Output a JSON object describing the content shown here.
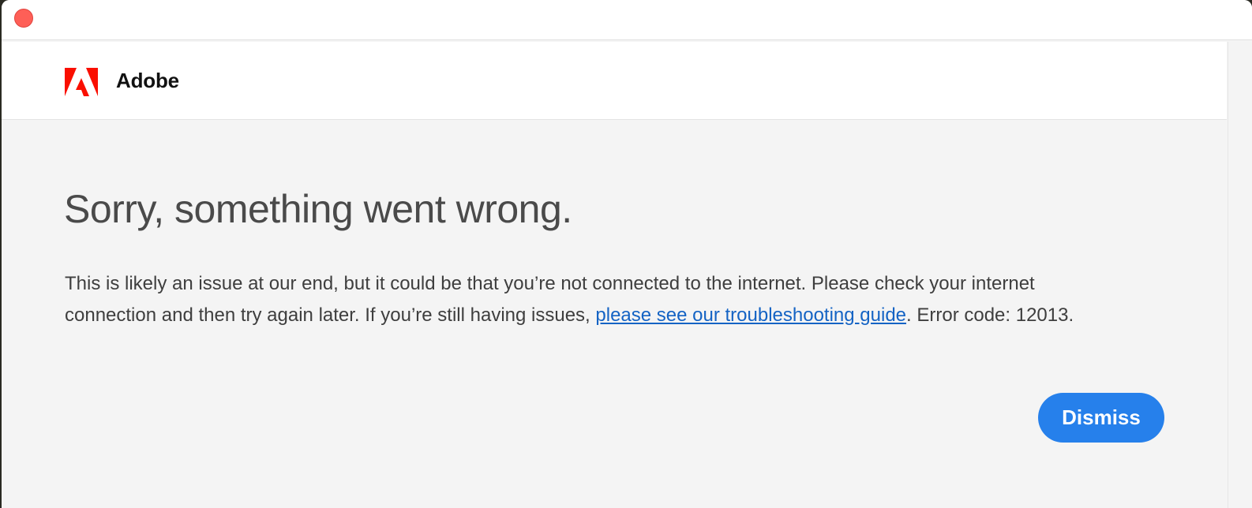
{
  "window": {
    "close_color": "#fe5f57"
  },
  "brand": {
    "name": "Adobe",
    "logo_icon": "adobe-logo-icon",
    "logo_color": "#fa0f00"
  },
  "error": {
    "title": "Sorry, something went wrong.",
    "message_part1": "This is likely an issue at our end, but it could be that you’re not connected to the internet. Please check your internet connection and then try again later. If you’re still having issues, ",
    "link_text": "please see our troubleshooting guide",
    "message_part2": ". Error code: 12013.",
    "link_color": "#1463c4"
  },
  "actions": {
    "dismiss_label": "Dismiss",
    "dismiss_color": "#2680eb"
  }
}
